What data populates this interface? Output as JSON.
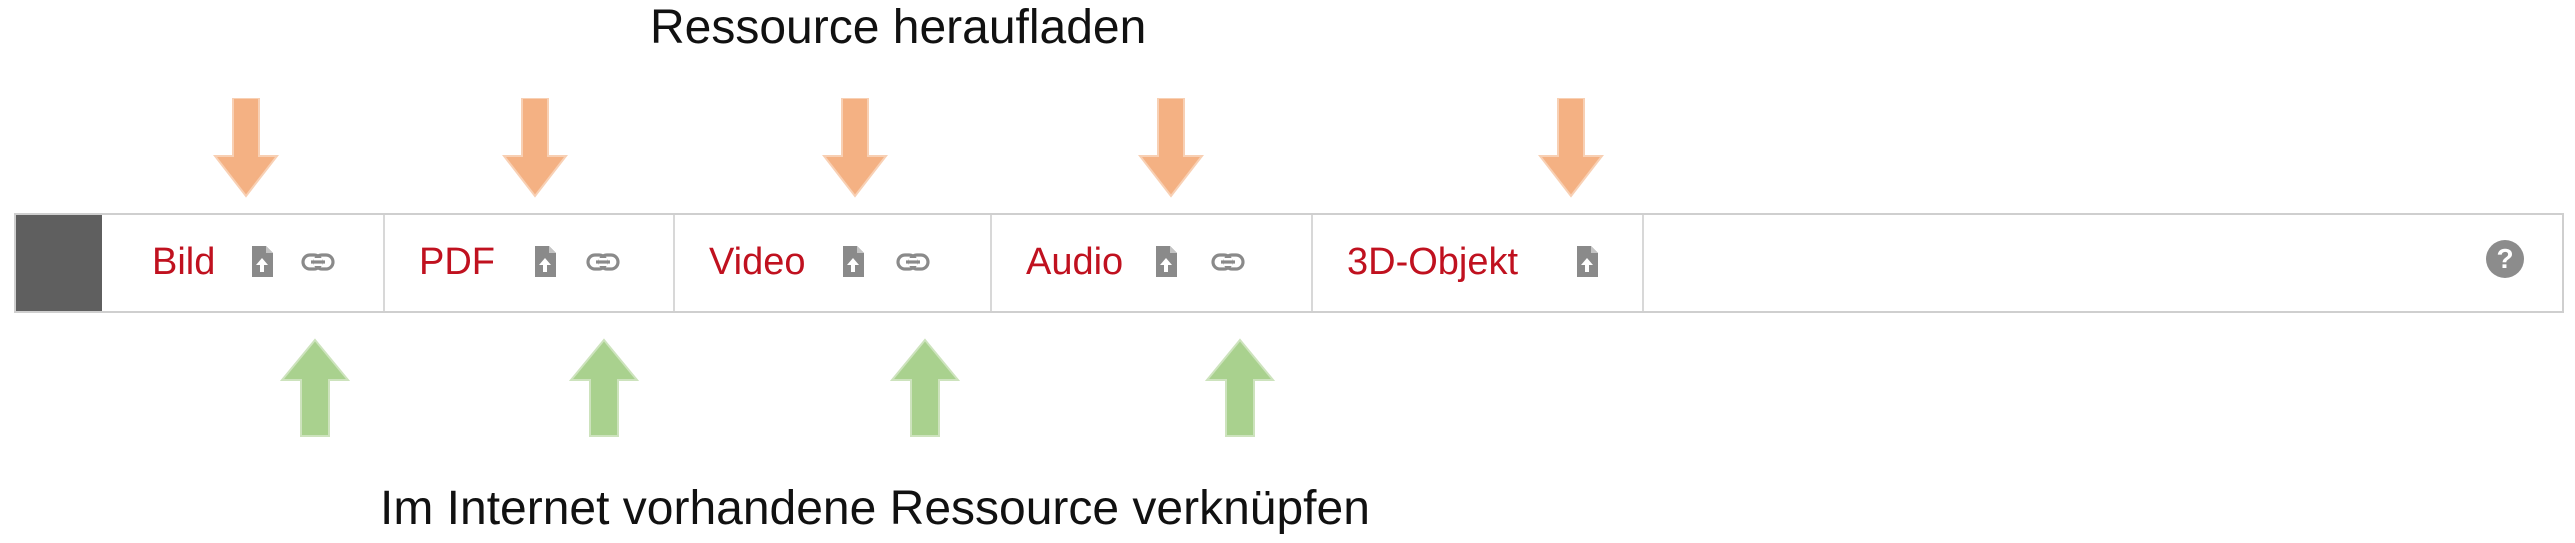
{
  "annotations": {
    "top_caption": "Ressource heraufladen",
    "bottom_caption": "Im Internet vorhandene Ressource verknüpfen",
    "upload_arrow_color": "#f4b183",
    "link_arrow_color": "#a9d18e"
  },
  "toolbar": {
    "items": [
      {
        "label": "Bild",
        "has_link": true
      },
      {
        "label": "PDF",
        "has_link": true
      },
      {
        "label": "Video",
        "has_link": true
      },
      {
        "label": "Audio",
        "has_link": true
      },
      {
        "label": "3D-Objekt",
        "has_link": false
      }
    ],
    "help_label": "?",
    "label_color": "#c0111f",
    "icon_color": "#8a8a8a",
    "icons": {
      "upload": "file-upload-icon",
      "link": "link-icon",
      "help": "help-icon"
    }
  }
}
